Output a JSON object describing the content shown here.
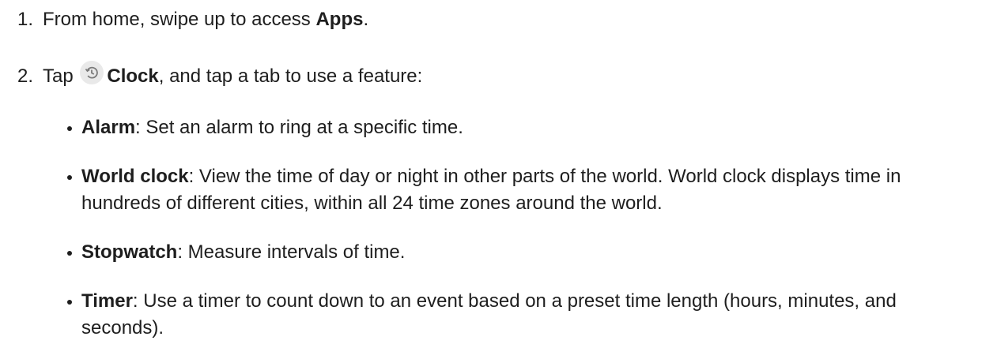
{
  "steps": [
    {
      "number": "1.",
      "pre": "From home, swipe up to access ",
      "bold": "Apps",
      "post": "."
    },
    {
      "number": "2.",
      "pre": "Tap ",
      "icon": "clock-app-icon",
      "bold": "Clock",
      "post": ", and tap a tab to use a feature:"
    }
  ],
  "features": [
    {
      "term": "Alarm",
      "desc": ": Set an alarm to ring at a specific time."
    },
    {
      "term": "World clock",
      "desc": ": View the time of day or night in other parts of the world. World clock displays time in hundreds of different cities, within all 24 time zones around the world."
    },
    {
      "term": "Stopwatch",
      "desc": ": Measure intervals of time."
    },
    {
      "term": "Timer",
      "desc": ": Use a timer to count down to an event based on a preset time length (hours, minutes, and seconds)."
    }
  ]
}
